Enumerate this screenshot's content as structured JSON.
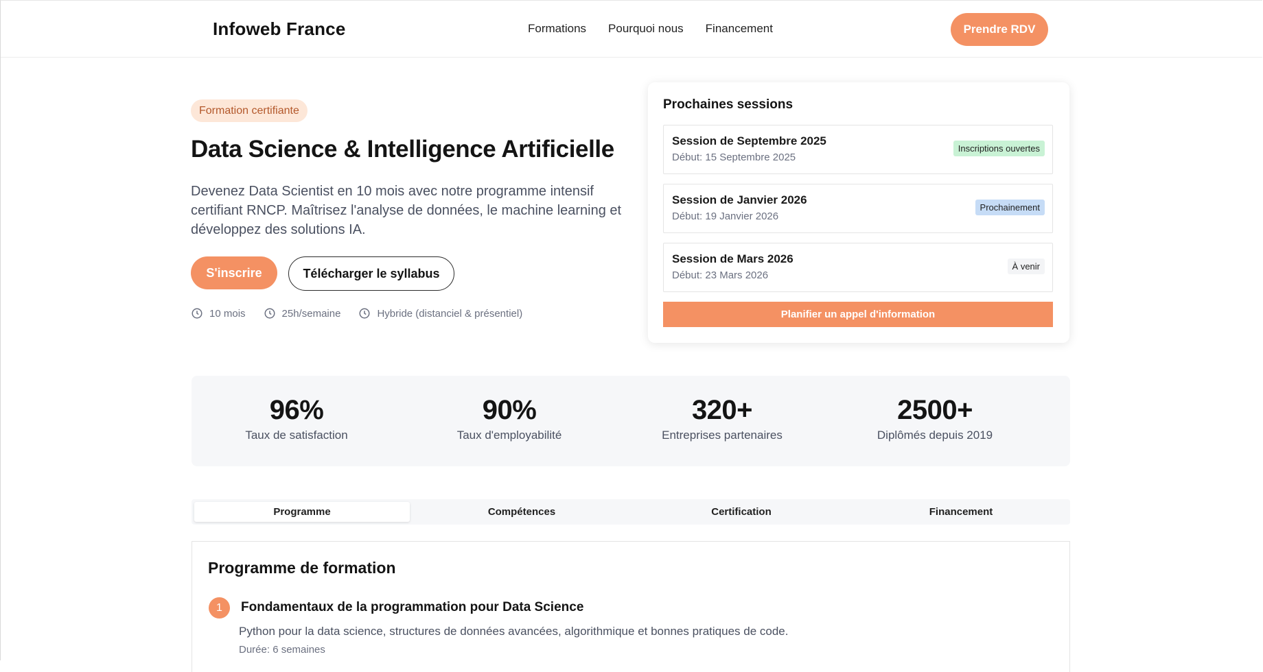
{
  "header": {
    "logo": "Infoweb France",
    "nav": [
      "Formations",
      "Pourquoi nous",
      "Financement"
    ],
    "cta": "Prendre RDV"
  },
  "hero": {
    "badge": "Formation certifiante",
    "title": "Data Science & Intelligence Artificielle",
    "description": "Devenez Data Scientist en 10 mois avec notre programme intensif certifiant RNCP. Maîtrisez l'analyse de données, le machine learning et développez des solutions IA.",
    "primary_button": "S'inscrire",
    "secondary_button": "Télécharger le syllabus",
    "meta": [
      {
        "icon": "clock-icon",
        "text": "10 mois"
      },
      {
        "icon": "clock-icon",
        "text": "25h/semaine"
      },
      {
        "icon": "clock-icon",
        "text": "Hybride (distanciel & présentiel)"
      }
    ]
  },
  "sessions": {
    "title": "Prochaines sessions",
    "items": [
      {
        "name": "Session de Septembre 2025",
        "date": "Début: 15 Septembre 2025",
        "status": "Inscriptions ouvertes",
        "status_color": "#c9f2d5"
      },
      {
        "name": "Session de Janvier 2026",
        "date": "Début: 19 Janvier 2026",
        "status": "Prochainement",
        "status_color": "#c6dcf6"
      },
      {
        "name": "Session de Mars 2026",
        "date": "Début: 23 Mars 2026",
        "status": "À venir",
        "status_color": "#f3f4f6"
      }
    ],
    "button": "Planifier un appel d'information"
  },
  "stats": [
    {
      "value": "96%",
      "label": "Taux de satisfaction"
    },
    {
      "value": "90%",
      "label": "Taux d'employabilité"
    },
    {
      "value": "320+",
      "label": "Entreprises partenaires"
    },
    {
      "value": "2500+",
      "label": "Diplômés depuis 2019"
    }
  ],
  "tabs": [
    "Programme",
    "Compétences",
    "Certification",
    "Financement"
  ],
  "program": {
    "title": "Programme de formation",
    "steps": [
      {
        "number": "1",
        "title": "Fondamentaux de la programmation pour Data Science",
        "description": "Python pour la data science, structures de données avancées, algorithmique et bonnes pratiques de code.",
        "duration": "Durée: 6 semaines"
      }
    ]
  },
  "colors": {
    "accent": "#f49163",
    "badge_bg": "#fde7d8",
    "badge_text": "#b3582b"
  }
}
